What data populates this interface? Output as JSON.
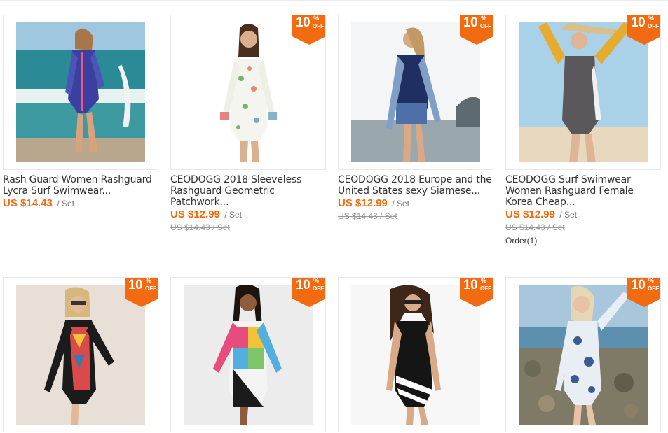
{
  "badge": {
    "num": "10",
    "pct": "%",
    "off": "OFF"
  },
  "products": [
    {
      "title_l1": "Rash Guard Women Rashguard",
      "title_l2": "Lycra Surf Swimwear...",
      "title_l3": "",
      "price": "US $14.43",
      "unit": "/ Set",
      "old_price": "",
      "orders": "",
      "badge": false
    },
    {
      "title_l1": "CEODOGG 2018 Sleeveless",
      "title_l2": "Rashguard Geometric",
      "title_l3": "Patchwork...",
      "price": "US $12.99",
      "unit": "/ Set",
      "old_price": "US $14.43 / Set",
      "orders": "",
      "badge": true
    },
    {
      "title_l1": "CEODOGG 2018 Europe and the",
      "title_l2": "United States sexy Siamese...",
      "title_l3": "",
      "price": "US $12.99",
      "unit": "/ Set",
      "old_price": "US $14.43 / Set",
      "orders": "",
      "badge": true
    },
    {
      "title_l1": "CEODOGG Surf Swimwear",
      "title_l2": "Women Rashguard Female",
      "title_l3": "Korea Cheap...",
      "price": "US $12.99",
      "unit": "/ Set",
      "old_price": "US $14.43 / Set",
      "orders": "Order(1)",
      "badge": true
    },
    {
      "badge": true
    },
    {
      "badge": true
    },
    {
      "badge": true
    },
    {
      "badge": true
    }
  ],
  "colors": {
    "accent": "#f36b11",
    "border": "#e8e8e8"
  }
}
